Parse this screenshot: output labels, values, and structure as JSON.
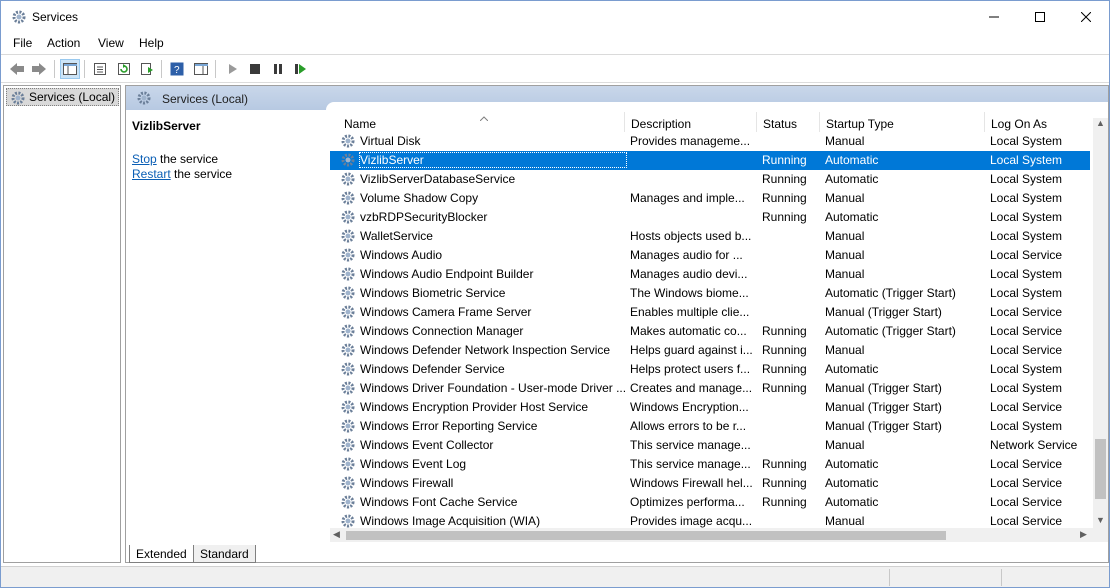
{
  "window": {
    "title": "Services"
  },
  "menu": {
    "items": [
      "File",
      "Action",
      "View",
      "Help"
    ]
  },
  "tree": {
    "root_label": "Services (Local)"
  },
  "content_header": {
    "label": "Services (Local)"
  },
  "details": {
    "service_name": "VizlibServer",
    "stop_link": "Stop",
    "stop_rest": " the service",
    "restart_link": "Restart",
    "restart_rest": " the service"
  },
  "columns": [
    "Name",
    "Description",
    "Status",
    "Startup Type",
    "Log On As"
  ],
  "rows": [
    {
      "name": "Virtual Disk",
      "description": "Provides manageme...",
      "status": "",
      "startup": "Manual",
      "logon": "Local System"
    },
    {
      "name": "VizlibServer",
      "description": "",
      "status": "Running",
      "startup": "Automatic",
      "logon": "Local System",
      "selected": true
    },
    {
      "name": "VizlibServerDatabaseService",
      "description": "",
      "status": "Running",
      "startup": "Automatic",
      "logon": "Local System"
    },
    {
      "name": "Volume Shadow Copy",
      "description": "Manages and imple...",
      "status": "Running",
      "startup": "Manual",
      "logon": "Local System"
    },
    {
      "name": "vzbRDPSecurityBlocker",
      "description": "",
      "status": "Running",
      "startup": "Automatic",
      "logon": "Local System"
    },
    {
      "name": "WalletService",
      "description": "Hosts objects used b...",
      "status": "",
      "startup": "Manual",
      "logon": "Local System"
    },
    {
      "name": "Windows Audio",
      "description": "Manages audio for ...",
      "status": "",
      "startup": "Manual",
      "logon": "Local Service"
    },
    {
      "name": "Windows Audio Endpoint Builder",
      "description": "Manages audio devi...",
      "status": "",
      "startup": "Manual",
      "logon": "Local System"
    },
    {
      "name": "Windows Biometric Service",
      "description": "The Windows biome...",
      "status": "",
      "startup": "Automatic (Trigger Start)",
      "logon": "Local System"
    },
    {
      "name": "Windows Camera Frame Server",
      "description": "Enables multiple clie...",
      "status": "",
      "startup": "Manual (Trigger Start)",
      "logon": "Local Service"
    },
    {
      "name": "Windows Connection Manager",
      "description": "Makes automatic co...",
      "status": "Running",
      "startup": "Automatic (Trigger Start)",
      "logon": "Local Service"
    },
    {
      "name": "Windows Defender Network Inspection Service",
      "description": "Helps guard against i...",
      "status": "Running",
      "startup": "Manual",
      "logon": "Local Service"
    },
    {
      "name": "Windows Defender Service",
      "description": "Helps protect users f...",
      "status": "Running",
      "startup": "Automatic",
      "logon": "Local System"
    },
    {
      "name": "Windows Driver Foundation - User-mode Driver ...",
      "description": "Creates and manage...",
      "status": "Running",
      "startup": "Manual (Trigger Start)",
      "logon": "Local System"
    },
    {
      "name": "Windows Encryption Provider Host Service",
      "description": "Windows Encryption...",
      "status": "",
      "startup": "Manual (Trigger Start)",
      "logon": "Local Service"
    },
    {
      "name": "Windows Error Reporting Service",
      "description": "Allows errors to be r...",
      "status": "",
      "startup": "Manual (Trigger Start)",
      "logon": "Local System"
    },
    {
      "name": "Windows Event Collector",
      "description": "This service manage...",
      "status": "",
      "startup": "Manual",
      "logon": "Network Service"
    },
    {
      "name": "Windows Event Log",
      "description": "This service manage...",
      "status": "Running",
      "startup": "Automatic",
      "logon": "Local Service"
    },
    {
      "name": "Windows Firewall",
      "description": "Windows Firewall hel...",
      "status": "Running",
      "startup": "Automatic",
      "logon": "Local Service"
    },
    {
      "name": "Windows Font Cache Service",
      "description": "Optimizes performa...",
      "status": "Running",
      "startup": "Automatic",
      "logon": "Local Service"
    },
    {
      "name": "Windows Image Acquisition (WIA)",
      "description": "Provides image acqu...",
      "status": "",
      "startup": "Manual",
      "logon": "Local Service"
    }
  ],
  "tabs": [
    "Extended",
    "Standard"
  ],
  "colors": {
    "selection": "#0078d7",
    "link": "#0b5fb5",
    "header_band": "#c9d7ea"
  }
}
